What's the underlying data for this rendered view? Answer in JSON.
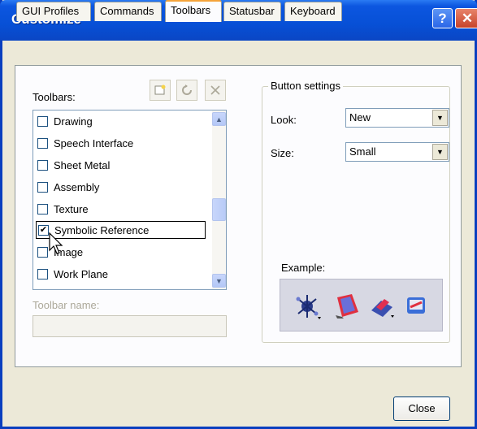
{
  "window": {
    "title": "Customize",
    "help_label": "?",
    "close_label": "✕"
  },
  "tabs": [
    {
      "label": "GUI Profiles",
      "active": false
    },
    {
      "label": "Commands",
      "active": false
    },
    {
      "label": "Toolbars",
      "active": true
    },
    {
      "label": "Statusbar",
      "active": false
    },
    {
      "label": "Keyboard",
      "active": false
    }
  ],
  "toolbars": {
    "label": "Toolbars:",
    "items": [
      {
        "label": "Drawing",
        "checked": false
      },
      {
        "label": "Speech Interface",
        "checked": false
      },
      {
        "label": "Sheet Metal",
        "checked": false
      },
      {
        "label": "Assembly",
        "checked": false
      },
      {
        "label": "Texture",
        "checked": false
      },
      {
        "label": "Symbolic Reference",
        "checked": true
      },
      {
        "label": "Image",
        "checked": false
      },
      {
        "label": "Work Plane",
        "checked": false
      }
    ],
    "name_label": "Toolbar name:",
    "name_value": ""
  },
  "button_settings": {
    "title": "Button settings",
    "look_label": "Look:",
    "look_value": "New",
    "size_label": "Size:",
    "size_value": "Small",
    "example_label": "Example:"
  },
  "footer": {
    "close_label": "Close"
  },
  "icons": [
    "new-toolbar-icon",
    "reset-icon",
    "delete-icon",
    "chevron-up-icon",
    "chevron-down-icon",
    "cursor-icon"
  ]
}
